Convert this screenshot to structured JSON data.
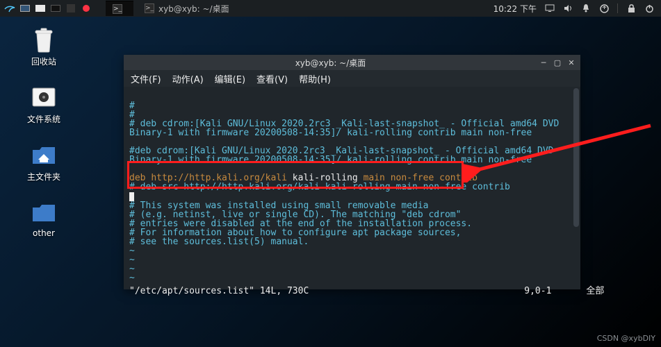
{
  "panel": {
    "task_active_title": "",
    "task_min_title": "xyb@xyb: ~/桌面",
    "time": "10:22 下午"
  },
  "desktop": {
    "trash": "回收站",
    "filesystem": "文件系统",
    "home": "主文件夹",
    "other": "other"
  },
  "term": {
    "title": "xyb@xyb: ~/桌面",
    "menu": {
      "file": "文件(F)",
      "action": "动作(A)",
      "edit": "编辑(E)",
      "view": "查看(V)",
      "help": "帮助(H)"
    },
    "l1": "#",
    "l2": "#",
    "l3": "# deb cdrom:[Kali GNU/Linux 2020.2rc3 _Kali-last-snapshot_ - Official amd64 DVD Binary-1 with firmware 20200508-14:35]/ kali-rolling contrib main non-free",
    "l4": "",
    "l5": "#deb cdrom:[Kali GNU/Linux 2020.2rc3 _Kali-last-snapshot_ - Official amd64 DVD Binary-1 with firmware 20200508-14:35]/ kali-rolling contrib main non-free",
    "l6": "",
    "deb_a": "deb ",
    "deb_b": "http://http.kali.org/kali",
    "deb_c": " kali-rolling ",
    "deb_d": "main non-free contrib",
    "l8": "# deb-src http://http.kali.org/kali kali-rolling main non-free contrib",
    "l9": "",
    "l10": "# This system was installed using small removable media",
    "l11": "# (e.g. netinst, live or single CD). The matching \"deb cdrom\"",
    "l12": "# entries were disabled at the end of the installation process.",
    "l13": "# For information about how to configure apt package sources,",
    "l14": "# see the sources.list(5) manual.",
    "tilde": "~",
    "status_file": "\"/etc/apt/sources.list\" 14L, 730C",
    "status_pos": "9,0-1",
    "status_all": "全部"
  },
  "watermark": "CSDN @xybDIY"
}
